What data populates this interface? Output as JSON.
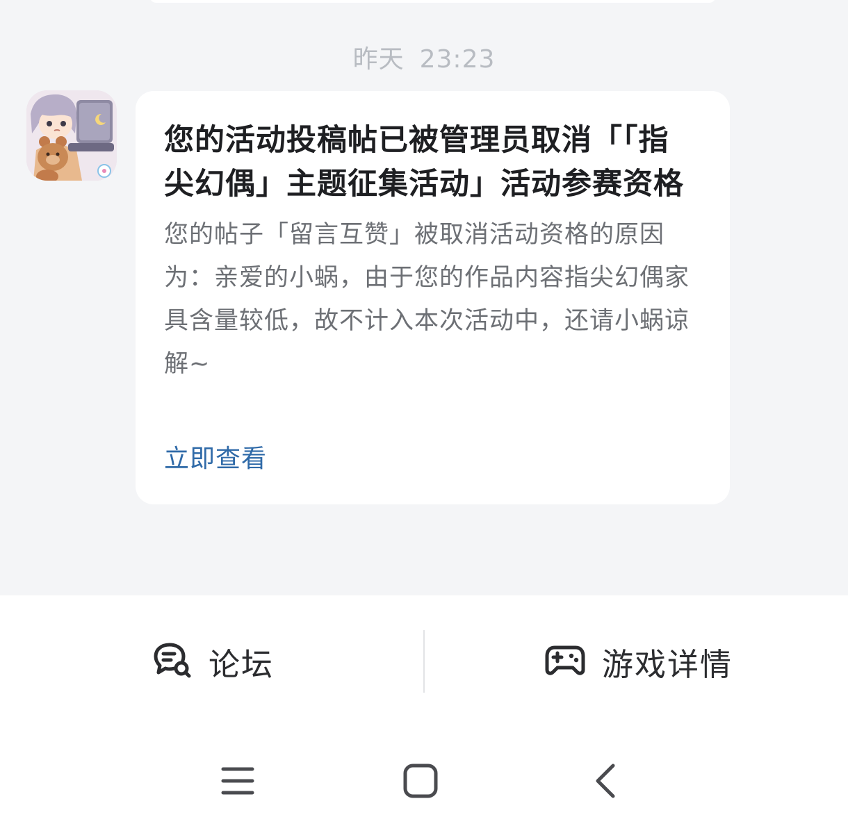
{
  "chat": {
    "timestamp_day": "昨天",
    "timestamp_time": "23:23"
  },
  "message": {
    "avatar_icon": "game-avatar-icon",
    "title": "您的活动投稿帖已被管理员取消「「指尖幻偶」主题征集活动」活动参赛资格",
    "body": "您的帖子「留言互赞」被取消活动资格的原因为：亲爱的小蜗，由于您的作品内容指尖幻偶家具含量较低，故不计入本次活动中，还请小蜗谅解~",
    "link_label": "立即查看",
    "link_color": "#2f6aa8"
  },
  "bottom_bar": {
    "forum_label": "论坛",
    "forum_icon": "forum-chat-icon",
    "game_label": "游戏详情",
    "game_icon": "gamepad-icon"
  },
  "system_nav": {
    "menu_icon": "menu-icon",
    "home_icon": "home-icon",
    "back_icon": "back-icon"
  }
}
